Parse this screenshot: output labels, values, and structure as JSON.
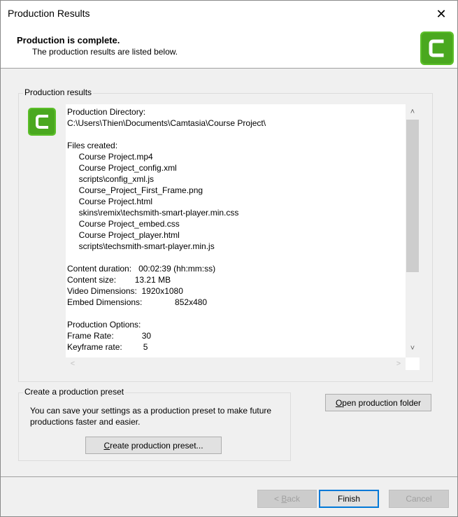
{
  "window": {
    "title": "Production Results",
    "close_glyph": "✕"
  },
  "header": {
    "title": "Production is complete.",
    "subtitle": "The production results are listed below.",
    "logo_icon": "camtasia-logo-icon",
    "accent": "#4caf2e"
  },
  "results_group": {
    "title": "Production results",
    "lines": [
      "Production Directory:",
      "C:\\Users\\Thien\\Documents\\Camtasia\\Course Project\\",
      "",
      "Files created:",
      "     Course Project.mp4",
      "     Course Project_config.xml",
      "     scripts\\config_xml.js",
      "     Course_Project_First_Frame.png",
      "     Course Project.html",
      "     skins\\remix\\techsmith-smart-player.min.css",
      "     Course Project_embed.css",
      "     Course Project_player.html",
      "     scripts\\techsmith-smart-player.min.js",
      "",
      "Content duration:   00:02:39 (hh:mm:ss)",
      "Content size:        13.21 MB",
      "Video Dimensions:  1920x1080",
      "Embed Dimensions:              852x480",
      "",
      "Production Options:",
      "Frame Rate:            30",
      "Keyframe rate:         5"
    ]
  },
  "preset_group": {
    "title": "Create a production preset",
    "description": "You can save your settings as a production preset to make future productions faster and easier.",
    "button_label_u": "C",
    "button_label_rest": "reate production preset..."
  },
  "open_folder": {
    "label_u": "O",
    "label_rest": "pen production folder"
  },
  "footer": {
    "back_prefix": "< ",
    "back_u": "B",
    "back_rest": "ack",
    "finish": "Finish",
    "cancel": "Cancel"
  }
}
